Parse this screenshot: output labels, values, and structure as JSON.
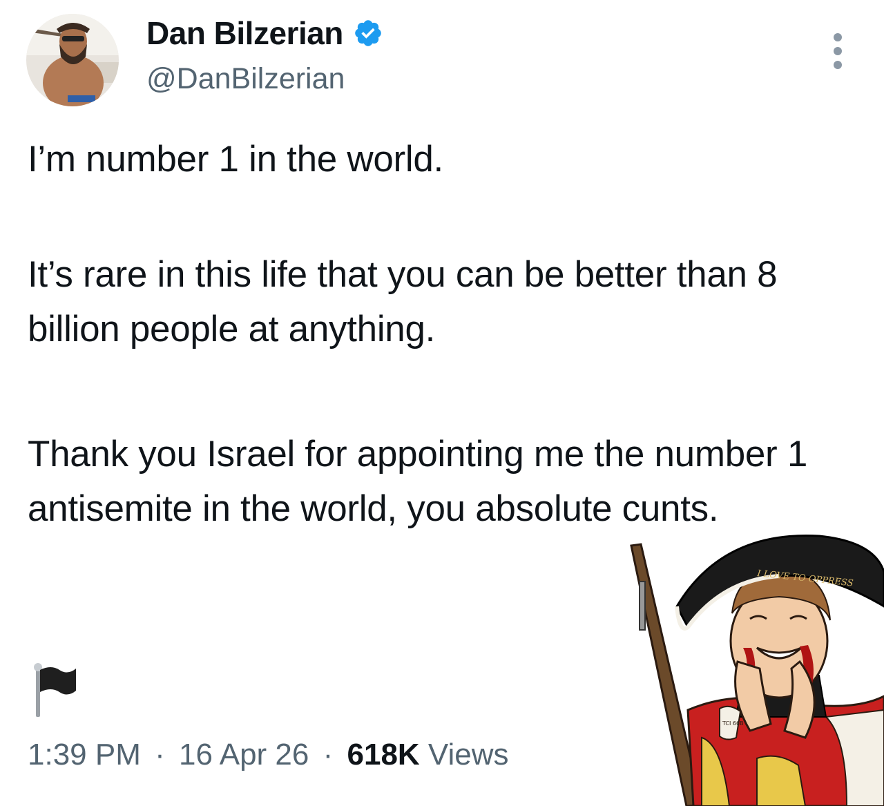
{
  "author": {
    "display_name": "Dan Bilzerian",
    "handle": "@DanBilzerian",
    "verified_icon": "verified-badge-icon",
    "avatar_icon": "profile-photo"
  },
  "tweet": {
    "paragraphs": [
      "I’m number 1 in the world.",
      "It’s rare in this life that you can be better than 8 billion people at anything.",
      "Thank you Israel for appointing me the number 1 antisemite in the world, you absolute cunts."
    ],
    "emoji": "black-flag-icon"
  },
  "meta": {
    "time": "1:39 PM",
    "separator": "·",
    "date": "16 Apr 26",
    "views_count": "618K",
    "views_label": "Views"
  },
  "meme": {
    "hat_text": "I LOVE TO OPPRESS",
    "cup_text": "TCI 66B"
  },
  "colors": {
    "text": "#0f1419",
    "secondary_text": "#536471",
    "verified_blue": "#1d9bf0",
    "coat_red": "#c8201f",
    "hat_black": "#1a1a1a"
  }
}
